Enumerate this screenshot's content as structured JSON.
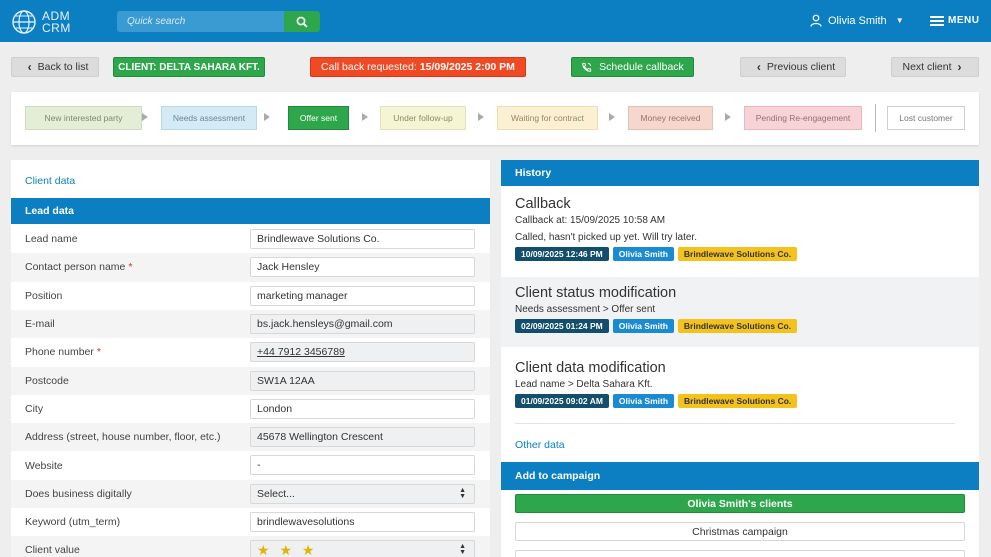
{
  "header": {
    "logo_text": "ADM\nCRM",
    "search_placeholder": "Quick search",
    "user_name": "Olivia Smith",
    "menu_label": "MENU"
  },
  "actions": {
    "back_label": "Back to list",
    "client_label": "CLIENT: DELTA SAHARA KFT.",
    "callback_prefix": "Call back requested:",
    "callback_datetime": "15/09/2025 2:00 PM",
    "schedule_label": "Schedule callback",
    "previous_label": "Previous client",
    "next_label": "Next client"
  },
  "pipeline": {
    "stages": [
      {
        "label": "New interested party",
        "bg": "#e4eed7",
        "border": "#cfdcbd",
        "color": "#7a8a6a"
      },
      {
        "label": "Needs assessment",
        "bg": "#d4eaf4",
        "border": "#b9d8e7",
        "color": "#6a8896"
      },
      {
        "label": "Offer sent",
        "bg": "#2ea64b",
        "border": "#228a3b",
        "color": "#ffffff"
      },
      {
        "label": "Under follow-up",
        "bg": "#f5f5d6",
        "border": "#e3e3b3",
        "color": "#8b8b60"
      },
      {
        "label": "Waiting for contract",
        "bg": "#fbefd4",
        "border": "#efdcb0",
        "color": "#9a8660"
      },
      {
        "label": "Money received",
        "bg": "#f6d7cd",
        "border": "#e9bfb1",
        "color": "#99746a"
      },
      {
        "label": "Pending Re-engagement",
        "bg": "#f7d2d7",
        "border": "#ebb7be",
        "color": "#9a6d74"
      },
      {
        "label": "Lost customer",
        "bg": "#ffffff",
        "border": "#cfcfcf",
        "color": "#777777"
      }
    ]
  },
  "client_data": {
    "title": "Client data",
    "section_label": "Lead data",
    "fields": [
      {
        "label": "Lead name",
        "value": "Brindlewave Solutions Co.",
        "required": "",
        "readonly": false
      },
      {
        "label": "Contact person name",
        "value": "Jack Hensley",
        "required": "*",
        "readonly": false
      },
      {
        "label": "Position",
        "value": "marketing manager",
        "required": "",
        "readonly": false
      },
      {
        "label": "E-mail",
        "value": "bs.jack.hensleys@gmail.com",
        "required": "",
        "readonly": true
      },
      {
        "label": "Phone number",
        "value": "+44 7912 3456789",
        "required": "*",
        "readonly": true
      },
      {
        "label": "Postcode",
        "value": "SW1A 12AA",
        "required": "",
        "readonly": true
      },
      {
        "label": "City",
        "value": "London",
        "required": "",
        "readonly": false
      },
      {
        "label": "Address (street, house number, floor, etc.)",
        "value": "45678 Wellington Crescent",
        "required": "",
        "readonly": true
      },
      {
        "label": "Website",
        "value": "-",
        "required": "",
        "readonly": false
      },
      {
        "label": "Does business digitally",
        "value": "Select...",
        "required": "",
        "readonly": true
      },
      {
        "label": "Keyword (utm_term)",
        "value": "brindlewavesolutions",
        "required": "",
        "readonly": false
      },
      {
        "label": "Client value",
        "value": "★ ★ ★",
        "required": "",
        "readonly": true
      }
    ]
  },
  "history": {
    "title": "History",
    "items": [
      {
        "title": "Callback",
        "line1": "Callback at: 15/09/2025 10:58 AM",
        "line2": "Called, hasn't picked up yet. Will try later.",
        "date": "10/09/2025 12:46 PM",
        "user": "Olivia Smith",
        "lead": "Brindlewave Solutions Co."
      },
      {
        "title": "Client status modification",
        "line1": "Needs assessment > Offer sent",
        "date": "02/09/2025 01:24 PM",
        "user": "Olivia Smith",
        "lead": "Brindlewave Solutions Co."
      },
      {
        "title": "Client data modification",
        "line1": "Lead name > Delta Sahara Kft.",
        "date": "01/09/2025 09:02 AM",
        "user": "Olivia Smith",
        "lead": "Brindlewave Solutions Co."
      }
    ],
    "other_data_label": "Other data"
  },
  "campaign": {
    "title": "Add to campaign",
    "items": [
      {
        "label": "Olivia Smith's clients",
        "active": true
      },
      {
        "label": "Christmas campaign",
        "active": false
      }
    ]
  },
  "colors": {
    "brand_blue": "#0b7fc2",
    "success_green": "#2ea64b",
    "alert_orange": "#ef4a24",
    "chip_navy": "#134f6d",
    "chip_yellow": "#f4c21d"
  }
}
